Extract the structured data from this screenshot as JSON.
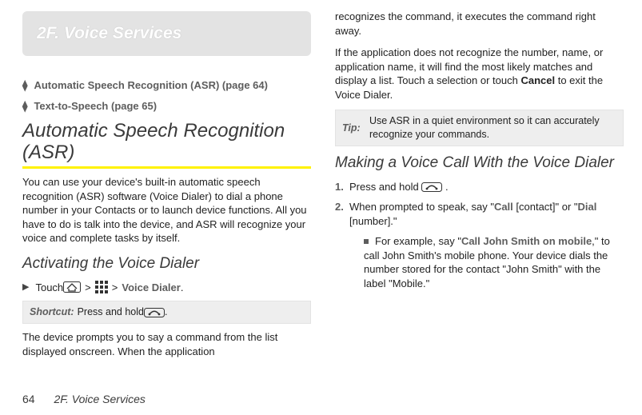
{
  "header": {
    "title": "2F.   Voice Services"
  },
  "toc": {
    "items": [
      "Automatic Speech Recognition (ASR) (page 64)",
      "Text-to-Speech (page 65)"
    ]
  },
  "h1": "Automatic Speech Recognition (ASR)",
  "intro": "You can use your device's built-in automatic speech recognition (ASR) software (Voice Dialer) to dial a phone number in your Contacts or to launch device functions. All you have to do is talk into the device, and ASR will recognize your voice and complete tasks by itself.",
  "sub1": "Activating the Voice Dialer",
  "step1": {
    "prefix": "Touch ",
    "sep": ">",
    "suffix_label": "Voice Dialer",
    "suffix_end": "."
  },
  "shortcut": {
    "label": "Shortcut:",
    "text_a": "Press and hold ",
    "text_b": "."
  },
  "para2a": "The device prompts you to say a command from the list displayed onscreen. When the application ",
  "para2b": "recognizes the command, it executes the command right away.",
  "para3_a": "If the application does not recognize the number, name, or application name, it will find the most likely matches and display a list. Touch a selection or touch ",
  "para3_bold": "Cancel",
  "para3_b": " to exit the Voice Dialer.",
  "tip": {
    "label": "Tip:",
    "text": "Use ASR in a quiet environment so it can accurately recognize your commands."
  },
  "sub2": "Making a Voice Call With the Voice Dialer",
  "ol": {
    "n1": "1.",
    "s1a": "Press and hold ",
    "s1b": ".",
    "n2": "2.",
    "s2a": "When prompted to speak, say \"",
    "s2bold1": "Call",
    "s2b": " [contact]\" or \"",
    "s2bold2": "Dial",
    "s2c": " [number].\"",
    "sub_a": "For example, say \"",
    "sub_bold": "Call John Smith on mobile",
    "sub_b": ",\" to call John Smith's mobile phone. Your device dials the number stored for the contact \"John Smith\" with the label \"Mobile.\""
  },
  "footer": {
    "page": "64",
    "section": "2F. Voice Services"
  }
}
